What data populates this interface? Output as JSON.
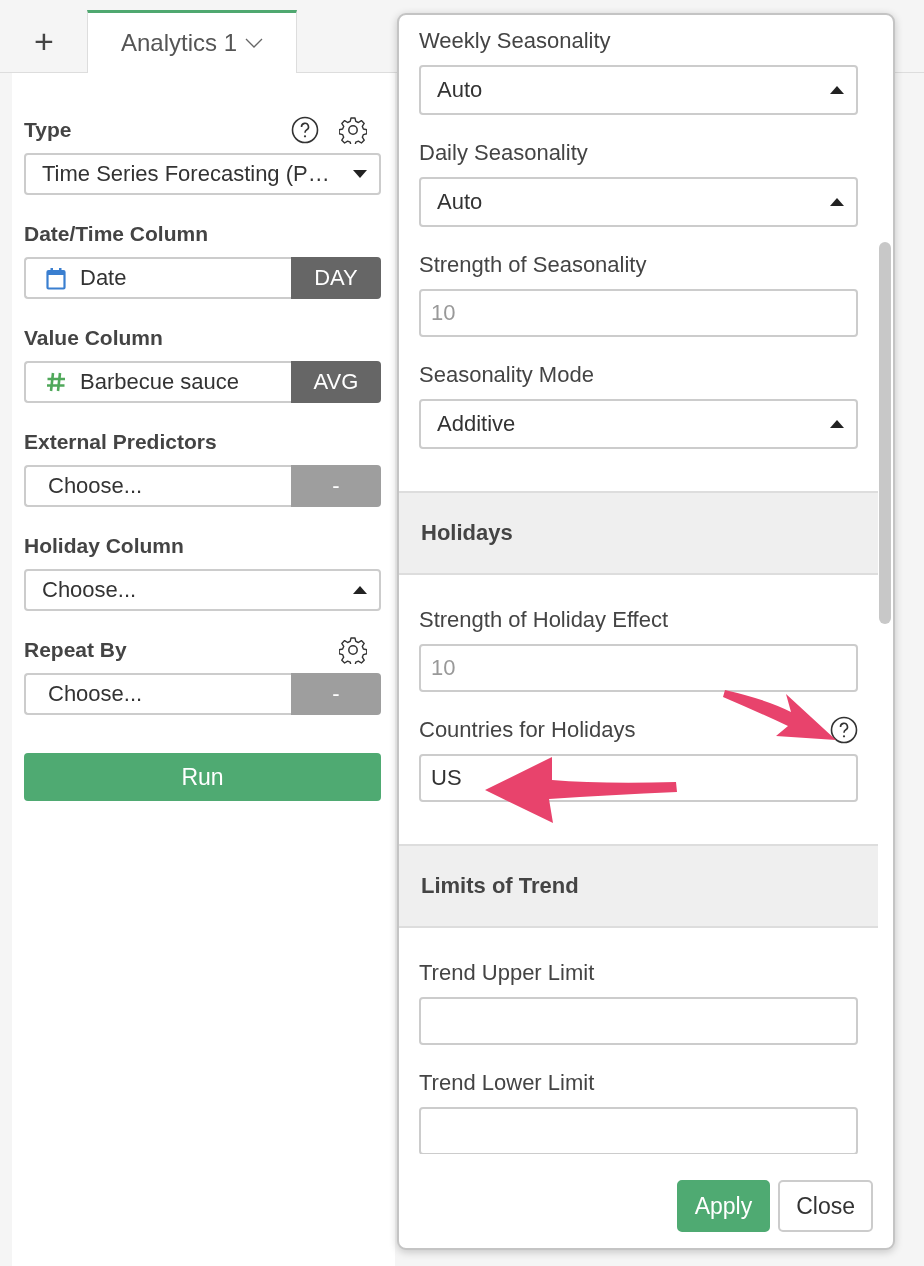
{
  "tabs": {
    "add_label": "+",
    "items": [
      {
        "label": "Analytics 1",
        "selected": true
      }
    ]
  },
  "left_panel": {
    "fields": [
      {
        "label": "Type",
        "kind": "menu",
        "value": "Time Series Forecasting (P…",
        "help_icon": true,
        "settings_icon": true
      },
      {
        "label": "Date/Time Column",
        "kind": "date_column",
        "value": "Date",
        "addon": "DAY",
        "addon_disabled": false
      },
      {
        "label": "Value Column",
        "kind": "number_column",
        "value": "Barbecue sauce",
        "addon": "AVG",
        "addon_disabled": false
      },
      {
        "label": "External Predictors",
        "kind": "column",
        "value": "Choose...",
        "addon": "-",
        "addon_disabled": true
      },
      {
        "label": "Holiday Column",
        "kind": "select",
        "value": "Choose..."
      },
      {
        "label": "Repeat By",
        "kind": "column",
        "value": "Choose...",
        "addon": "-",
        "addon_disabled": true,
        "settings_icon": true
      }
    ],
    "run_button": "Run"
  },
  "dialog": {
    "items": [
      {
        "kind": "select",
        "label": "Weekly Seasonality",
        "value": "Auto"
      },
      {
        "kind": "select",
        "label": "Daily Seasonality",
        "value": "Auto"
      },
      {
        "kind": "input",
        "label": "Strength of Seasonality",
        "placeholder": "10"
      },
      {
        "kind": "select",
        "label": "Seasonality Mode",
        "value": "Additive"
      },
      {
        "kind": "section",
        "label": "Holidays"
      },
      {
        "kind": "input",
        "label": "Strength of Holiday Effect",
        "placeholder": "10"
      },
      {
        "kind": "input",
        "label": "Countries for Holidays",
        "value": "US",
        "help_icon": true
      },
      {
        "kind": "section",
        "label": "Limits of Trend"
      },
      {
        "kind": "input",
        "label": "Trend Upper Limit"
      },
      {
        "kind": "input",
        "label": "Trend Lower Limit"
      }
    ],
    "buttons": [
      {
        "label": "Apply",
        "primary": true
      },
      {
        "label": "Close",
        "primary": false
      }
    ]
  }
}
